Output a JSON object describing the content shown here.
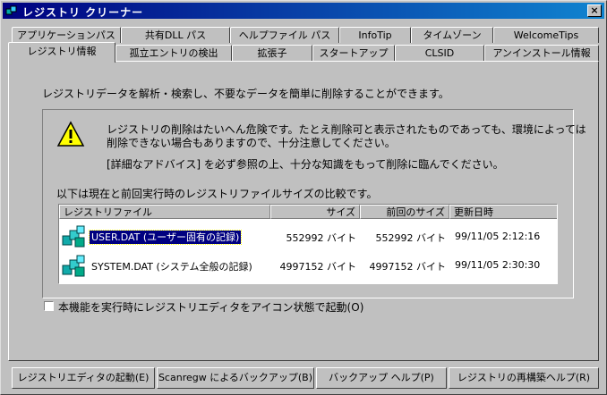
{
  "window": {
    "title": "レジストリ クリーナー",
    "close_label": "×"
  },
  "tabs_row1": [
    "アプリケーションパス",
    "共有DLL パス",
    "ヘルプファイル パス",
    "InfoTip",
    "タイムゾーン",
    "WelcomeTips"
  ],
  "tabs_row2": [
    "レジストリ情報",
    "孤立エントリの検出",
    "拡張子",
    "スタートアップ",
    "CLSID",
    "アンインストール情報"
  ],
  "main": {
    "description": "レジストリデータを解析・検索し、不要なデータを簡単に削除することができます。",
    "warning_line1": "レジストリの削除はたいへん危険です。たとえ削除可と表示されたものであっても、環境によっては",
    "warning_line2": "削除できない場合もありますので、十分注意してください。",
    "advice": "[詳細なアドバイス] を必ず参照の上、十分な知識をもって削除に臨んでください。",
    "list_caption": "以下は現在と前回実行時のレジストリファイルサイズの比較です。"
  },
  "table": {
    "headers": [
      "レジストリファイル",
      "サイズ",
      "前回のサイズ",
      "更新日時"
    ],
    "rows": [
      {
        "file": "USER.DAT (ユーザー固有の記録)",
        "size": "552992 バイト",
        "prev": "552992 バイト",
        "date": "99/11/05 2:12:16"
      },
      {
        "file": "SYSTEM.DAT (システム全般の記録)",
        "size": "4997152 バイト",
        "prev": "4997152 バイト",
        "date": "99/11/05 2:30:30"
      }
    ]
  },
  "checkbox": {
    "label": "本機能を実行時にレジストリエディタをアイコン状態で起動(O)"
  },
  "buttons": [
    "レジストリエディタの起動(E)",
    "Scanregw によるバックアップ(B)",
    "バックアップ ヘルプ(P)",
    "レジストリの再構築ヘルプ(R)"
  ],
  "colors": {
    "titlebar_start": "#000080",
    "titlebar_end": "#1084d0",
    "face": "#c0c0c0",
    "selection": "#000080"
  }
}
